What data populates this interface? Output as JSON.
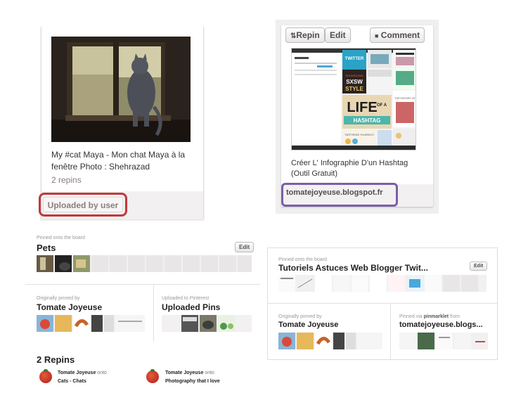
{
  "pin1": {
    "description": "My #cat Maya - Mon chat Maya à la fenêtre Photo : Shehrazad",
    "repins": "2 repins",
    "source_button": "Uploaded by user"
  },
  "pin2": {
    "repin_label": "Repin",
    "edit_label": "Edit",
    "comment_label": "Comment",
    "screenshot": {
      "tile1": "TWITTER",
      "tile2_line1": "SHOWDOWN",
      "tile2_line2": "SXSW",
      "tile2_line3": "STYLE",
      "tile3_line1": "LIFE",
      "tile3_line2": "OF A",
      "tile3_line3": "HASHTAG",
      "tile4": "TWITTERIZE YOURSELF!",
      "tile5": "THE HISTORY OF"
    },
    "description": "Créer L' Infographie D'un Hashtag (Outil Gratuit)",
    "source": "tomatejoyeuse.blogspot.fr"
  },
  "panelA": {
    "board_label": "Pinned onto the board",
    "board_name": "Pets",
    "edit_label": "Edit",
    "orig_label": "Originally pinned by",
    "orig_name": "Tomate Joyeuse",
    "uploaded_label": "Uploaded to Pinterest",
    "uploaded_name": "Uploaded Pins"
  },
  "panelB": {
    "board_label": "Pinned onto the board",
    "board_name": "Tutoriels Astuces Web Blogger Twit...",
    "edit_label": "Edit",
    "orig_label": "Originally pinned by",
    "orig_name": "Tomate Joyeuse",
    "via_label_prefix": "Pinned via",
    "via_tool": "pinmarklet",
    "via_label_suffix": "from",
    "via_name": "tomatejoyeuse.blogs..."
  },
  "repins": {
    "title": "2 Repins",
    "items": [
      {
        "user": "Tomate Joyeuse",
        "onto": "onto",
        "board": "Cats - Chats"
      },
      {
        "user": "Tomate Joyeuse",
        "onto": "onto",
        "board": "Photography that I love"
      }
    ]
  }
}
